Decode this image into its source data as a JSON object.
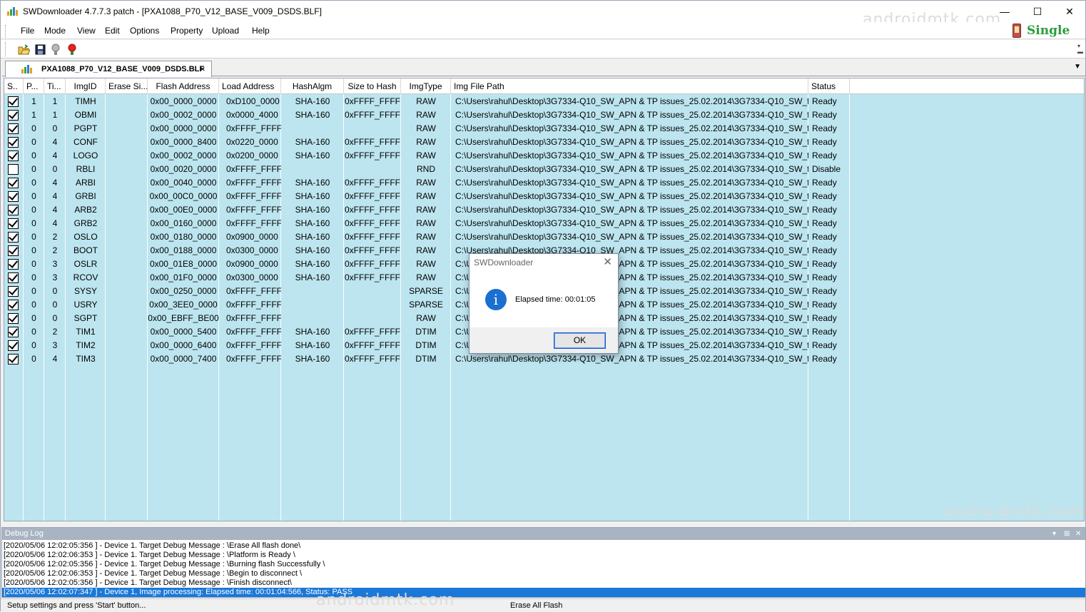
{
  "window": {
    "title": "SWDownloader 4.7.7.3 patch - [PXA1088_P70_V12_BASE_V009_DSDS.BLF]",
    "minimize_glyph": "—",
    "maximize_glyph": "☐",
    "close_glyph": "✕",
    "watermark": "androidmtk.com"
  },
  "menu": {
    "items": [
      "File",
      "Mode",
      "View",
      "Edit",
      "Options",
      "Property",
      "Upload",
      "Help"
    ],
    "mode_badge": "Single"
  },
  "toolbar": {
    "icons": [
      "open-folder-icon",
      "save-icon",
      "bulb-off-icon",
      "bulb-on-icon"
    ]
  },
  "tab": {
    "label": "PXA1088_P70_V12_BASE_V009_DSDS.BLF",
    "close_glyph": "×",
    "dropdown_glyph": "▼"
  },
  "grid": {
    "headers": [
      "S..",
      "P...",
      "Ti...",
      "ImgID",
      "Erase Si...",
      "Flash Address",
      "Load Address",
      "HashAlgm",
      "Size to Hash",
      "ImgType",
      "Img File Path",
      "Status"
    ],
    "rows": [
      {
        "checked": true,
        "p": "1",
        "ti": "1",
        "id": "TIMH",
        "erase": "",
        "flash": "0x00_0000_0000",
        "load": "0xD100_0000",
        "hash": "SHA-160",
        "size": "0xFFFF_FFFF",
        "type": "RAW",
        "path": "C:\\Users\\rahul\\Desktop\\3G7334-Q10_SW_APN & TP issues_25.02.2014\\3G7334-Q10_SW_for...",
        "status": "Ready"
      },
      {
        "checked": true,
        "p": "1",
        "ti": "1",
        "id": "OBMI",
        "erase": "",
        "flash": "0x00_0002_0000",
        "load": "0x0000_4000",
        "hash": "SHA-160",
        "size": "0xFFFF_FFFF",
        "type": "RAW",
        "path": "C:\\Users\\rahul\\Desktop\\3G7334-Q10_SW_APN & TP issues_25.02.2014\\3G7334-Q10_SW_for...",
        "status": "Ready"
      },
      {
        "checked": true,
        "p": "0",
        "ti": "0",
        "id": "PGPT",
        "erase": "",
        "flash": "0x00_0000_0000",
        "load": "0xFFFF_FFFF",
        "hash": "",
        "size": "",
        "type": "RAW",
        "path": "C:\\Users\\rahul\\Desktop\\3G7334-Q10_SW_APN & TP issues_25.02.2014\\3G7334-Q10_SW_for...",
        "status": "Ready"
      },
      {
        "checked": true,
        "p": "0",
        "ti": "4",
        "id": "CONF",
        "erase": "",
        "flash": "0x00_0000_8400",
        "load": "0x0220_0000",
        "hash": "SHA-160",
        "size": "0xFFFF_FFFF",
        "type": "RAW",
        "path": "C:\\Users\\rahul\\Desktop\\3G7334-Q10_SW_APN & TP issues_25.02.2014\\3G7334-Q10_SW_for...",
        "status": "Ready"
      },
      {
        "checked": true,
        "p": "0",
        "ti": "4",
        "id": "LOGO",
        "erase": "",
        "flash": "0x00_0002_0000",
        "load": "0x0200_0000",
        "hash": "SHA-160",
        "size": "0xFFFF_FFFF",
        "type": "RAW",
        "path": "C:\\Users\\rahul\\Desktop\\3G7334-Q10_SW_APN & TP issues_25.02.2014\\3G7334-Q10_SW_for...",
        "status": "Ready"
      },
      {
        "checked": false,
        "p": "0",
        "ti": "0",
        "id": "RBLI",
        "erase": "",
        "flash": "0x00_0020_0000",
        "load": "0xFFFF_FFFF",
        "hash": "",
        "size": "",
        "type": "RND",
        "path": "C:\\Users\\rahul\\Desktop\\3G7334-Q10_SW_APN & TP issues_25.02.2014\\3G7334-Q10_SW_for...",
        "status": "Disable"
      },
      {
        "checked": true,
        "p": "0",
        "ti": "4",
        "id": "ARBI",
        "erase": "",
        "flash": "0x00_0040_0000",
        "load": "0xFFFF_FFFF",
        "hash": "SHA-160",
        "size": "0xFFFF_FFFF",
        "type": "RAW",
        "path": "C:\\Users\\rahul\\Desktop\\3G7334-Q10_SW_APN & TP issues_25.02.2014\\3G7334-Q10_SW_for...",
        "status": "Ready"
      },
      {
        "checked": true,
        "p": "0",
        "ti": "4",
        "id": "GRBI",
        "erase": "",
        "flash": "0x00_00C0_0000",
        "load": "0xFFFF_FFFF",
        "hash": "SHA-160",
        "size": "0xFFFF_FFFF",
        "type": "RAW",
        "path": "C:\\Users\\rahul\\Desktop\\3G7334-Q10_SW_APN & TP issues_25.02.2014\\3G7334-Q10_SW_for...",
        "status": "Ready"
      },
      {
        "checked": true,
        "p": "0",
        "ti": "4",
        "id": "ARB2",
        "erase": "",
        "flash": "0x00_00E0_0000",
        "load": "0xFFFF_FFFF",
        "hash": "SHA-160",
        "size": "0xFFFF_FFFF",
        "type": "RAW",
        "path": "C:\\Users\\rahul\\Desktop\\3G7334-Q10_SW_APN & TP issues_25.02.2014\\3G7334-Q10_SW_for...",
        "status": "Ready"
      },
      {
        "checked": true,
        "p": "0",
        "ti": "4",
        "id": "GRB2",
        "erase": "",
        "flash": "0x00_0160_0000",
        "load": "0xFFFF_FFFF",
        "hash": "SHA-160",
        "size": "0xFFFF_FFFF",
        "type": "RAW",
        "path": "C:\\Users\\rahul\\Desktop\\3G7334-Q10_SW_APN & TP issues_25.02.2014\\3G7334-Q10_SW_for...",
        "status": "Ready"
      },
      {
        "checked": true,
        "p": "0",
        "ti": "2",
        "id": "OSLO",
        "erase": "",
        "flash": "0x00_0180_0000",
        "load": "0x0900_0000",
        "hash": "SHA-160",
        "size": "0xFFFF_FFFF",
        "type": "RAW",
        "path": "C:\\Users\\rahul\\Desktop\\3G7334-Q10_SW_APN & TP issues_25.02.2014\\3G7334-Q10_SW_for...",
        "status": "Ready"
      },
      {
        "checked": true,
        "p": "0",
        "ti": "2",
        "id": "BOOT",
        "erase": "",
        "flash": "0x00_0188_0000",
        "load": "0x0300_0000",
        "hash": "SHA-160",
        "size": "0xFFFF_FFFF",
        "type": "RAW",
        "path": "C:\\Users\\rahul\\Desktop\\3G7334-Q10_SW_APN & TP issues_25.02.2014\\3G7334-Q10_SW_for...",
        "status": "Ready"
      },
      {
        "checked": true,
        "p": "0",
        "ti": "3",
        "id": "OSLR",
        "erase": "",
        "flash": "0x00_01E8_0000",
        "load": "0x0900_0000",
        "hash": "SHA-160",
        "size": "0xFFFF_FFFF",
        "type": "RAW",
        "path": "C:\\Users\\rahul\\Desktop\\3G7334-Q10_SW_APN & TP issues_25.02.2014\\3G7334-Q10_SW_for...",
        "status": "Ready"
      },
      {
        "checked": true,
        "p": "0",
        "ti": "3",
        "id": "RCOV",
        "erase": "",
        "flash": "0x00_01F0_0000",
        "load": "0x0300_0000",
        "hash": "SHA-160",
        "size": "0xFFFF_FFFF",
        "type": "RAW",
        "path": "C:\\Users\\rahul\\Desktop\\3G7334-Q10_SW_APN & TP issues_25.02.2014\\3G7334-Q10_SW_for...",
        "status": "Ready"
      },
      {
        "checked": true,
        "p": "0",
        "ti": "0",
        "id": "SYSY",
        "erase": "",
        "flash": "0x00_0250_0000",
        "load": "0xFFFF_FFFF",
        "hash": "",
        "size": "",
        "type": "SPARSE",
        "path": "C:\\Users\\rahul\\Desktop\\3G7334-Q10_SW_APN & TP issues_25.02.2014\\3G7334-Q10_SW_for...",
        "status": "Ready"
      },
      {
        "checked": true,
        "p": "0",
        "ti": "0",
        "id": "USRY",
        "erase": "",
        "flash": "0x00_3EE0_0000",
        "load": "0xFFFF_FFFF",
        "hash": "",
        "size": "",
        "type": "SPARSE",
        "path": "C:\\Users\\rahul\\Desktop\\3G7334-Q10_SW_APN & TP issues_25.02.2014\\3G7334-Q10_SW_for...",
        "status": "Ready"
      },
      {
        "checked": true,
        "p": "0",
        "ti": "0",
        "id": "SGPT",
        "erase": "",
        "flash": "0x00_EBFF_BE00",
        "load": "0xFFFF_FFFF",
        "hash": "",
        "size": "",
        "type": "RAW",
        "path": "C:\\Users\\rahul\\Desktop\\3G7334-Q10_SW_APN & TP issues_25.02.2014\\3G7334-Q10_SW_for...",
        "status": "Ready"
      },
      {
        "checked": true,
        "p": "0",
        "ti": "2",
        "id": "TIM1",
        "erase": "",
        "flash": "0x00_0000_5400",
        "load": "0xFFFF_FFFF",
        "hash": "SHA-160",
        "size": "0xFFFF_FFFF",
        "type": "DTIM",
        "path": "C:\\Users\\rahul\\Desktop\\3G7334-Q10_SW_APN & TP issues_25.02.2014\\3G7334-Q10_SW_for...",
        "status": "Ready"
      },
      {
        "checked": true,
        "p": "0",
        "ti": "3",
        "id": "TIM2",
        "erase": "",
        "flash": "0x00_0000_6400",
        "load": "0xFFFF_FFFF",
        "hash": "SHA-160",
        "size": "0xFFFF_FFFF",
        "type": "DTIM",
        "path": "C:\\Users\\rahul\\Desktop\\3G7334-Q10_SW_APN & TP issues_25.02.2014\\3G7334-Q10_SW_for...",
        "status": "Ready"
      },
      {
        "checked": true,
        "p": "0",
        "ti": "4",
        "id": "TIM3",
        "erase": "",
        "flash": "0x00_0000_7400",
        "load": "0xFFFF_FFFF",
        "hash": "SHA-160",
        "size": "0xFFFF_FFFF",
        "type": "DTIM",
        "path": "C:\\Users\\rahul\\Desktop\\3G7334-Q10_SW_APN & TP issues_25.02.2014\\3G7334-Q10_SW_for...",
        "status": "Ready"
      }
    ]
  },
  "dialog": {
    "title": "SWDownloader",
    "close_glyph": "✕",
    "icon_glyph": "i",
    "message": "Elapsed time: 00:01:05",
    "ok_label": "OK"
  },
  "debug_log": {
    "title": "Debug Log",
    "controls": [
      "▾",
      "⊞",
      "✕"
    ],
    "lines": [
      "[2020/05/06 12:02:05:356 ] - Device 1. Target Debug Message : \\Erase All flash done\\",
      "[2020/05/06 12:02:06:353 ] - Device 1. Target Debug Message : \\Platform is Ready \\",
      "[2020/05/06 12:02:05:356 ] - Device 1. Target Debug Message : \\Burning flash Successfully \\",
      "[2020/05/06 12:02:06:353 ] - Device 1. Target Debug Message : \\Begin to disconnect \\",
      "[2020/05/06 12:02:05:356 ] - Device 1. Target Debug Message : \\Finish disconnect\\",
      "[2020/05/06 12:02:07:347 ] - Device 1, Image processing: Elapsed time: 00:01:04:566, Status: PASS"
    ]
  },
  "status_bar": {
    "left": "Setup settings and press 'Start' button...",
    "middle": "Erase All Flash"
  },
  "colors": {
    "grid_bg": "#bce5ef",
    "selected_log": "#1a78d8",
    "badge_green": "#2a9d3a",
    "info_blue": "#1a6fd0"
  }
}
